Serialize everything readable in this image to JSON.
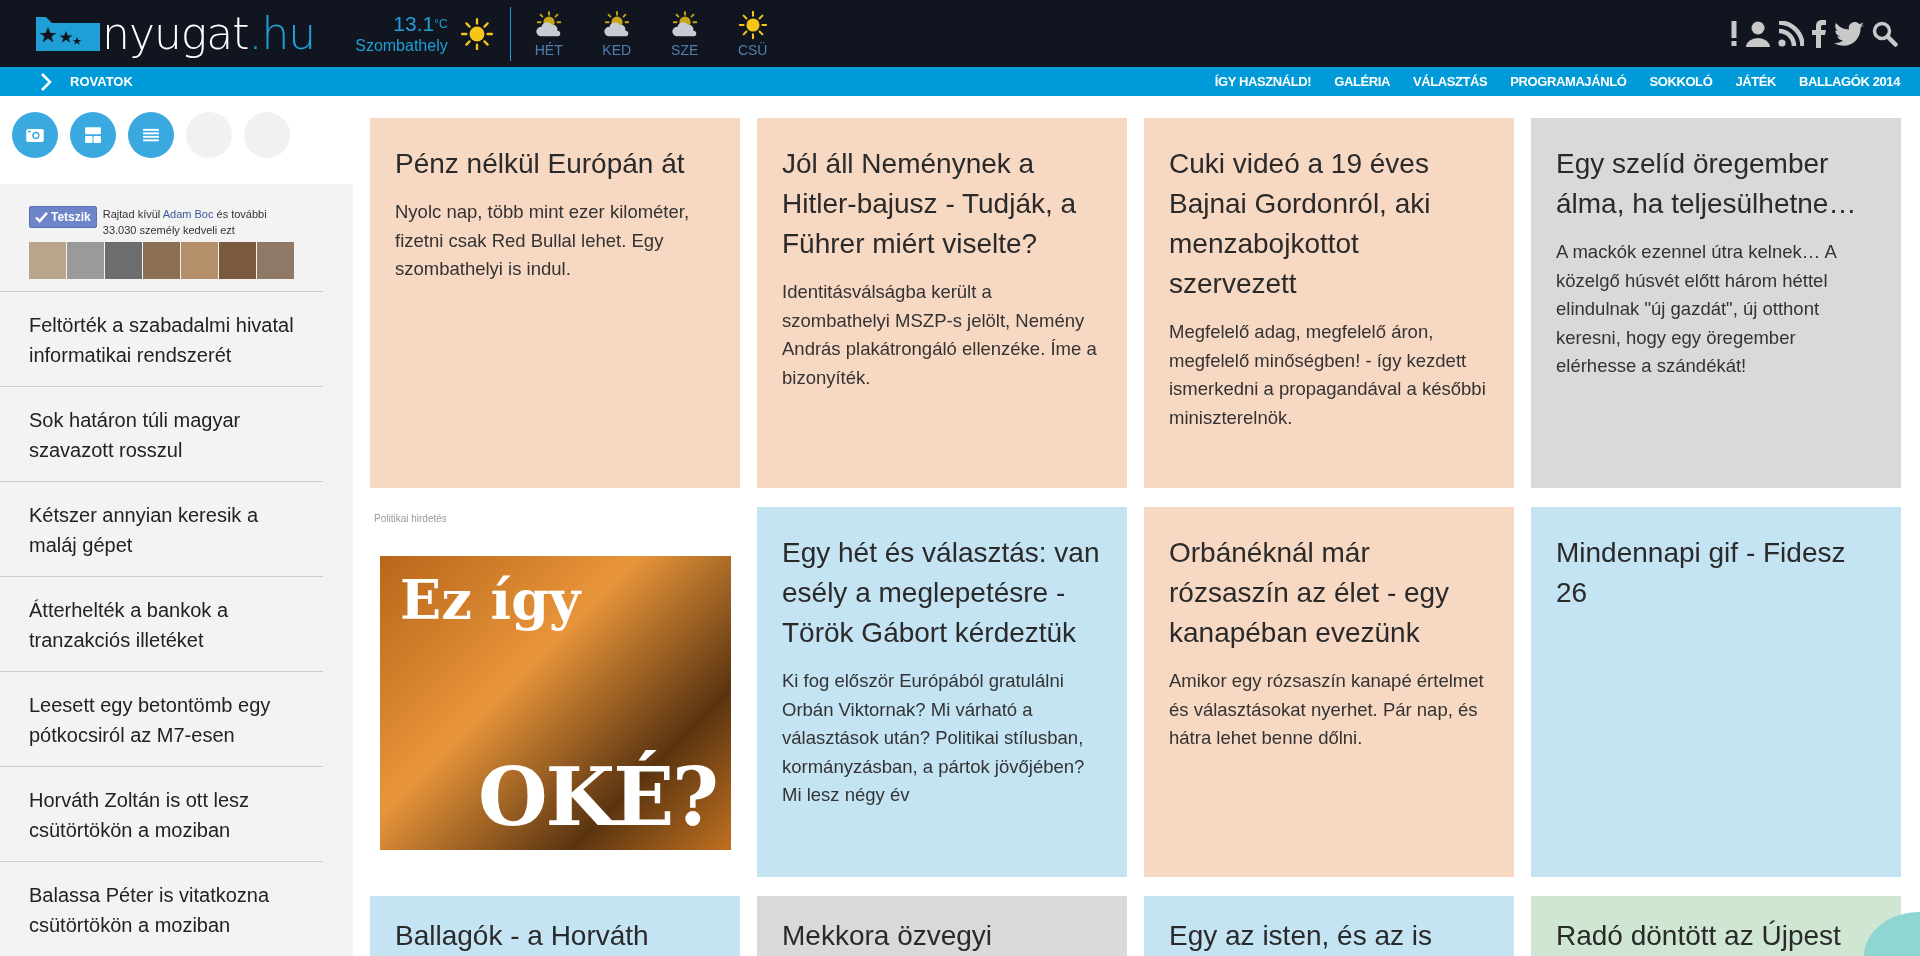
{
  "header": {
    "logo": {
      "name": "nyugat",
      "suffix": ".hu"
    },
    "weather": {
      "temperature": "13.1",
      "unit": "°C",
      "city": "Szombathely",
      "kind": "sunny",
      "forecast": [
        {
          "day": "HÉT",
          "kind": "partly-cloudy"
        },
        {
          "day": "KED",
          "kind": "partly-cloudy"
        },
        {
          "day": "SZE",
          "kind": "partly-cloudy"
        },
        {
          "day": "CSÜ",
          "kind": "sunny"
        }
      ]
    }
  },
  "nav": {
    "menu_label": "ROVATOK",
    "links": [
      "ÍGY HASZNÁLD!",
      "GALÉRIA",
      "VÁLASZTÁS",
      "PROGRAMAJÁNLÓ",
      "SOKKOLÓ",
      "JÁTÉK",
      "BALLAGÓK 2014"
    ]
  },
  "sidebar": {
    "view_buttons": [
      {
        "kind": "camera"
      },
      {
        "kind": "tiles"
      },
      {
        "kind": "list"
      },
      {
        "kind": "blank"
      },
      {
        "kind": "blank"
      }
    ],
    "like_box": {
      "button": "Tetszik",
      "text_before": "Rajtad kívül ",
      "friend": "Adam Boc",
      "text_after": " és további 33.030 személy kedveli ezt"
    },
    "headlines": [
      "Feltörték a szabadalmi hivatal informatikai rendszerét",
      "Sok határon túli magyar szavazott rosszul",
      "Kétszer annyian keresik a maláj gépet",
      "Átterhelték a bankok a tranzakciós illetéket",
      "Leesett egy betontömb egy pótkocsiról az M7-esen",
      "Horváth Zoltán is ott lesz csütörtökön a moziban",
      "Balassa Péter is vitatkozna csütörtökön a moziban"
    ]
  },
  "cards": [
    {
      "kind": "article",
      "color": "#f7d8c3",
      "title": "Pénz nélkül Európán át",
      "body": "Nyolc nap, több mint ezer kilométer, fizetni csak Red Bullal lehet. Egy szombathelyi is indul."
    },
    {
      "kind": "article",
      "color": "#f7d8c3",
      "title": "Jól áll Neménynek a Hitler-bajusz - Tudják, a Führer miért viselte?",
      "body": "Identitásválságba került a szombathelyi MSZP-s jelölt, Nemény András plakátrongáló ellenzéke. Íme a bizonyíték."
    },
    {
      "kind": "article",
      "color": "#f7d8c3",
      "title": "Cuki videó a 19 éves Bajnai Gordonról, aki menzabojkottot szervezett",
      "body": "Megfelelő adag, megfelelő áron, megfelelő minőségben! - így kezdett ismerkedni a propagandával a későbbi miniszterelnök."
    },
    {
      "kind": "article",
      "color": "#d9d9d9",
      "title": "Egy szelíd öregember álma, ha teljesülhetne…",
      "body": "A mackók ezennel útra kelnek… A közelgő húsvét előtt három héttel elindulnak \"új gazdát\", új otthont keresni, hogy egy öregember elérhesse a szándékát!"
    },
    {
      "kind": "ad",
      "label": "Politikai hirdetés",
      "headline_top": "Ez így",
      "headline_bottom": "OKÉ?"
    },
    {
      "kind": "article",
      "color": "#c4e3f3",
      "title": "Egy hét és választás: van esély a meglepetésre - Török Gábort kérdeztük",
      "body": "Ki fog először Európából gratulálni Orbán Viktornak? Mi várható a választások után? Politikai stílusban, kormányzásban, a pártok jövőjében? Mi lesz négy év"
    },
    {
      "kind": "article",
      "color": "#f7d8c3",
      "title": "Orbánéknál már rózsaszín az élet - egy kanapéban evezünk",
      "body": "Amikor egy rózsaszín kanapé értelmet és választásokat nyerhet. Pár nap, és hátra lehet benne dőlni."
    },
    {
      "kind": "article",
      "color": "#c4e3f3",
      "title": "Mindennapi gif - Fidesz 26"
    },
    {
      "kind": "partial",
      "color": "#c4e3f3",
      "title": "Ballagók - a Horváth"
    },
    {
      "kind": "partial",
      "color": "#d9d9d9",
      "title": "Mekkora özvegyi"
    },
    {
      "kind": "partial",
      "color": "#c4e3f3",
      "title": "Egy az isten, és az is"
    },
    {
      "kind": "partial",
      "color": "#cfe6d3",
      "title": "Radó döntött az Újpest"
    }
  ]
}
